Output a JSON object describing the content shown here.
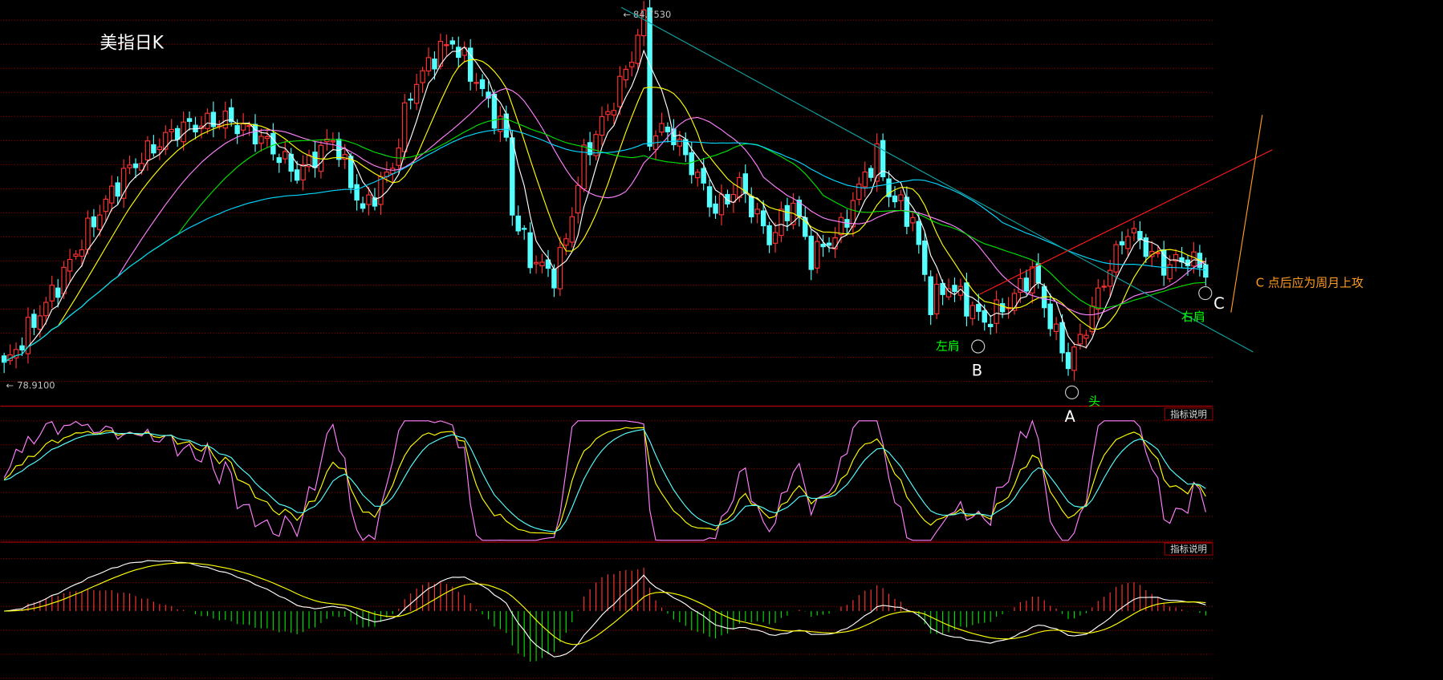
{
  "title": "美指日K",
  "indicator_button_label": "指标说明",
  "colors": {
    "background": "#000000",
    "grid": "#8b0000",
    "up": "#ff3232",
    "down": "#54ffff",
    "ma5": "#ffffff",
    "ma10": "#ffff00",
    "ma20": "#ff80ff",
    "ma30": "#00e000",
    "ma60": "#00d8ff",
    "annotation_green": "#00ff00",
    "annotation_orange": "#ff9a1e",
    "downtrend_line": "#0fa0a0",
    "neckline": "#ff1a1a"
  },
  "annotations": {
    "left_shoulder": "左肩",
    "head": "头",
    "right_shoulder": "右肩",
    "point_a": "A",
    "point_b": "B",
    "point_c": "C",
    "note": "C 点后应为周月上攻"
  },
  "chart_data": {
    "type": "candlestick",
    "title": "美指日K",
    "max_label": "84.7530",
    "min_label": "78.9100",
    "max_price": 84.753,
    "min_price": 78.91,
    "candle_count": 202,
    "close_anchors": [
      [
        0,
        79.18
      ],
      [
        3,
        79.61
      ],
      [
        8,
        80.33
      ],
      [
        15,
        81.49
      ],
      [
        20,
        82.22
      ],
      [
        25,
        82.65
      ],
      [
        29,
        82.94
      ],
      [
        37,
        83.09
      ],
      [
        43,
        82.8
      ],
      [
        49,
        82.22
      ],
      [
        55,
        82.8
      ],
      [
        60,
        81.64
      ],
      [
        65,
        82.36
      ],
      [
        68,
        83.52
      ],
      [
        72,
        84.1
      ],
      [
        75,
        84.32
      ],
      [
        80,
        83.52
      ],
      [
        84,
        82.8
      ],
      [
        85,
        81.64
      ],
      [
        88,
        80.91
      ],
      [
        92,
        80.62
      ],
      [
        94,
        81.2
      ],
      [
        97,
        82.51
      ],
      [
        102,
        83.38
      ],
      [
        105,
        84.1
      ],
      [
        107,
        84.68
      ],
      [
        108,
        82.8
      ],
      [
        111,
        82.94
      ],
      [
        115,
        82.36
      ],
      [
        119,
        81.64
      ],
      [
        123,
        82.07
      ],
      [
        128,
        81.2
      ],
      [
        132,
        81.78
      ],
      [
        135,
        80.91
      ],
      [
        140,
        81.35
      ],
      [
        144,
        82.22
      ],
      [
        146,
        82.51
      ],
      [
        148,
        81.93
      ],
      [
        152,
        81.49
      ],
      [
        155,
        80.19
      ],
      [
        158,
        80.48
      ],
      [
        164,
        79.9
      ],
      [
        168,
        80.19
      ],
      [
        172,
        80.7
      ],
      [
        175,
        79.9
      ],
      [
        178,
        79.25
      ],
      [
        180,
        79.61
      ],
      [
        183,
        80.33
      ],
      [
        185,
        80.77
      ],
      [
        188,
        81.35
      ],
      [
        191,
        81.06
      ],
      [
        194,
        80.77
      ],
      [
        198,
        80.91
      ],
      [
        201,
        80.7
      ]
    ],
    "moving_averages": [
      5,
      10,
      20,
      30,
      60
    ],
    "indicators": [
      "KDJ(9,3,3)",
      "MACD(12,26,9)"
    ]
  }
}
